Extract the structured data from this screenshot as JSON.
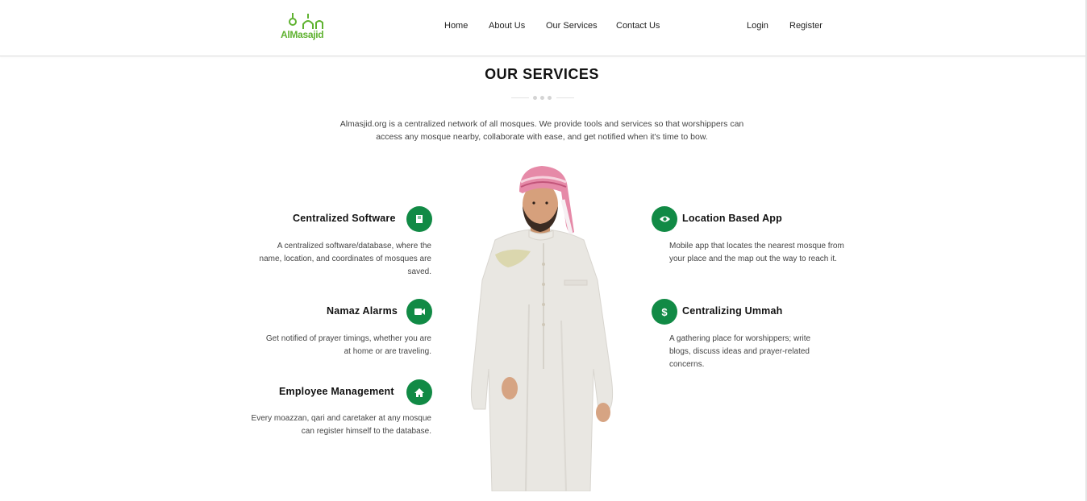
{
  "header": {
    "logo_text": "AlMasajid",
    "nav": [
      "Home",
      "About Us",
      "Our Services",
      "Contact Us"
    ],
    "auth": [
      "Login",
      "Register"
    ]
  },
  "section": {
    "title": "OUR SERVICES",
    "intro": "Almasjid.org is a centralized network of all mosques. We provide tools and services so that worshippers can access any mosque nearby, collaborate with ease, and get notified when it's time to bow."
  },
  "services_left": [
    {
      "title": "Centralized Software",
      "icon": "book-icon",
      "desc": "A centralized software/database, where the name, location, and coordinates of mosques are saved."
    },
    {
      "title": "Namaz Alarms",
      "icon": "video-camera-icon",
      "desc": "Get notified of prayer timings, whether you are at home or are traveling."
    },
    {
      "title": "Employee Management",
      "icon": "home-icon",
      "desc": "Every moazzan, qari and caretaker at any mosque can register himself to the database."
    }
  ],
  "services_right": [
    {
      "title": "Location Based App",
      "icon": "eye-icon",
      "desc": "Mobile app that locates the nearest mosque from your place and the map out the way to reach it."
    },
    {
      "title": "Centralizing Ummah",
      "icon": "dollar-icon",
      "desc": "A gathering place for worshippers; write blogs, discuss ideas and prayer-related concerns."
    }
  ],
  "colors": {
    "accent": "#118a45",
    "logo": "#5fb230"
  }
}
